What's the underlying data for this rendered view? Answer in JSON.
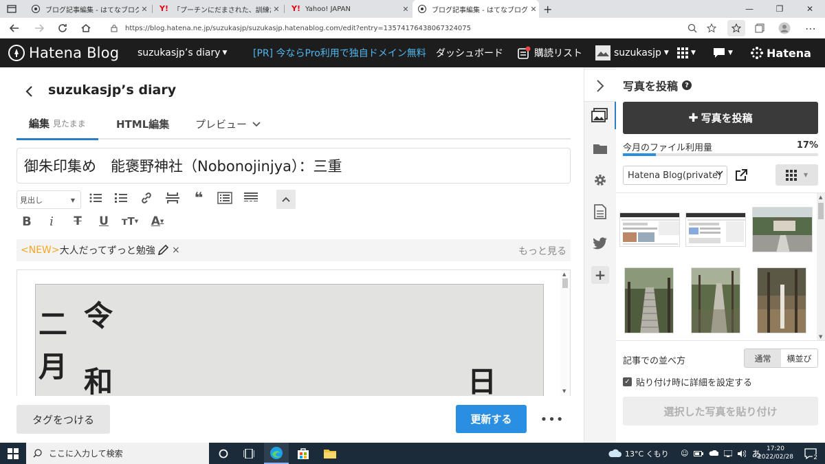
{
  "browser": {
    "tabs": [
      {
        "title": "ブログ記事編集 - はてなブログ",
        "active": false
      },
      {
        "title": "「プーチンにだまされた、訓練だと思って」",
        "active": false
      },
      {
        "title": "Yahoo! JAPAN",
        "active": false
      },
      {
        "title": "ブログ記事編集 - はてなブログ",
        "active": true
      }
    ],
    "new_tab": "+",
    "url": "https://blog.hatena.ne.jp/suzukasjp/suzukasjp.hatenablog.com/edit?entry=13574176438067324075"
  },
  "header": {
    "logo": "Hatena Blog",
    "blog_menu": "suzukasjp’s diary",
    "promo": "[PR] 今ならPro利用で独自ドメイン無料",
    "dashboard": "ダッシュボード",
    "subscriptions": "購読リスト",
    "user": "suzukasjp",
    "hatena": "Hatena"
  },
  "editor": {
    "blog_title": "suzukasjp’s diary",
    "tabs": {
      "edit": "編集",
      "edit_sub": "見たまま",
      "html": "HTML編集",
      "preview": "プレビュー"
    },
    "post_title": "御朱印集め　能褒野神社（Nobonojinjya）：三重",
    "heading_select": "見出し",
    "news_new": "<NEW>",
    "news_text": "大人だってずっと勉強",
    "news_close": "×",
    "news_more": "もっと見る",
    "calligraphy": [
      "二",
      "月",
      "令",
      "和",
      "日"
    ],
    "tag_button": "タグをつける",
    "update_button": "更新する",
    "more_button": "•••"
  },
  "panel": {
    "title": "写真を投稿",
    "help": "?",
    "post_button": "写真を投稿",
    "usage_label": "今月のファイル利用量",
    "usage_pct": "17%",
    "usage_value": 0.17,
    "album_select": "Hatena Blog(private)",
    "arrange_label": "記事での並べ方",
    "arrange_options": [
      "通常",
      "横並び"
    ],
    "arrange_selected": "通常",
    "checkbox_label": "貼り付け時に詳細を設定する",
    "checkbox_checked": true,
    "paste_button": "選択した写真を貼り付け"
  },
  "taskbar": {
    "search_placeholder": "ここに入力して検索",
    "weather": "13°C くもり",
    "ime": "あ",
    "time": "17:20",
    "date": "2022/02/28",
    "notifications": "2"
  },
  "colors": {
    "header_bg": "#1d1d1d",
    "promo": "#4fb6ee",
    "accent": "#2a8fe0",
    "new_tag": "#f5a623",
    "taskbar_bg": "#1c2b39"
  }
}
